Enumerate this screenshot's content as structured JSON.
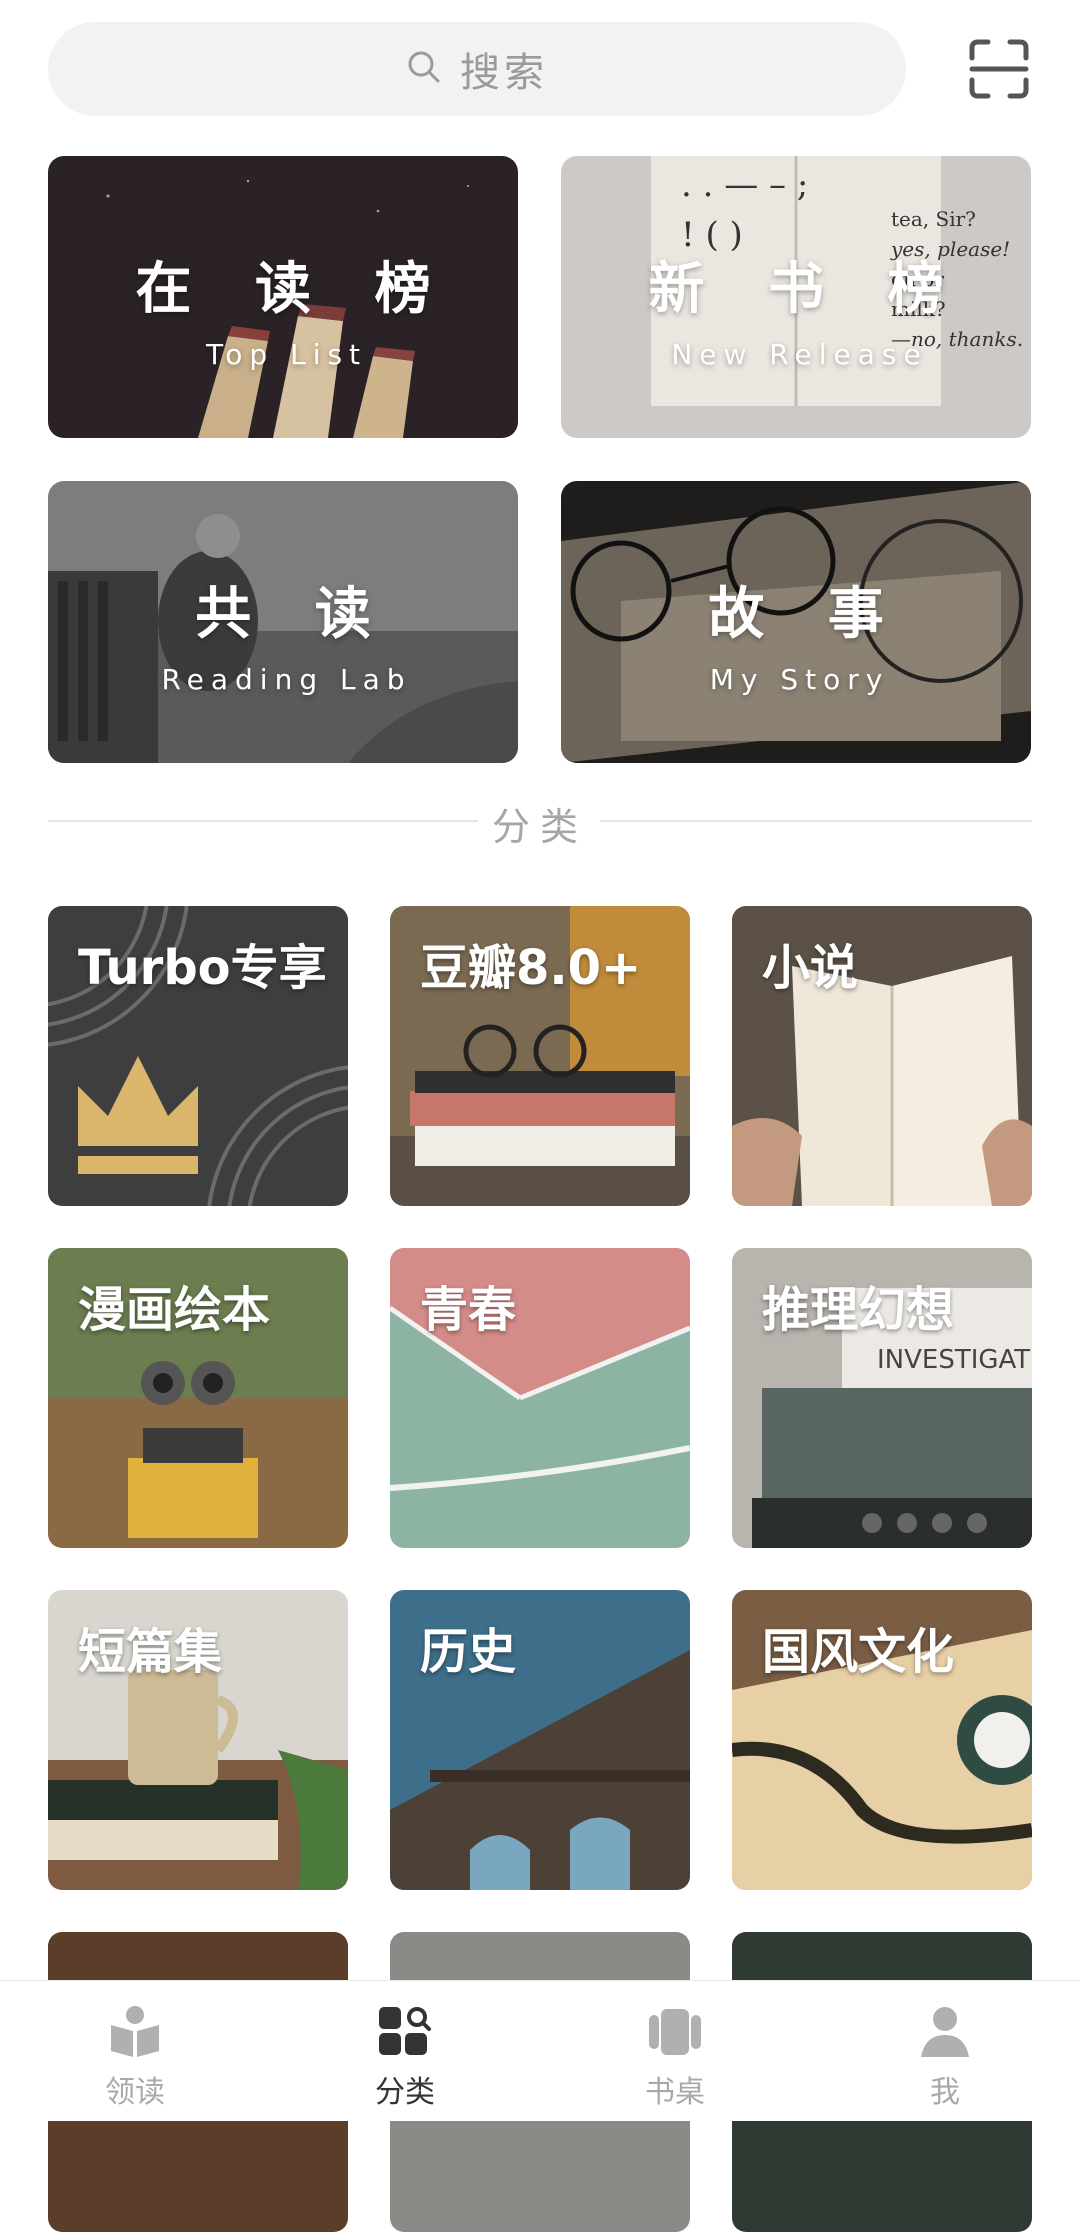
{
  "search": {
    "placeholder": "搜索",
    "icon": "search-icon",
    "scan_icon": "scan-icon"
  },
  "banners": [
    {
      "title": "在 读 榜",
      "subtitle": "Top List"
    },
    {
      "title": "新 书 榜",
      "subtitle": "New Release"
    },
    {
      "title": "共 读",
      "subtitle": "Reading Lab"
    },
    {
      "title": "故 事",
      "subtitle": "My Story"
    }
  ],
  "section": {
    "title": "分类"
  },
  "categories": [
    {
      "label": "Turbo专享"
    },
    {
      "label": "豆瓣8.0+"
    },
    {
      "label": "小说"
    },
    {
      "label": "漫画绘本"
    },
    {
      "label": "青春"
    },
    {
      "label": "推理幻想"
    },
    {
      "label": "短篇集"
    },
    {
      "label": "历史"
    },
    {
      "label": "国风文化"
    }
  ],
  "nav": [
    {
      "label": "领读",
      "icon": "book-open-icon",
      "active": false
    },
    {
      "label": "分类",
      "icon": "category-grid-icon",
      "active": true
    },
    {
      "label": "书桌",
      "icon": "desk-icon",
      "active": false
    },
    {
      "label": "我",
      "icon": "profile-icon",
      "active": false
    }
  ],
  "colors": {
    "active_nav": "#333333",
    "inactive_nav": "#a9a9a9"
  }
}
